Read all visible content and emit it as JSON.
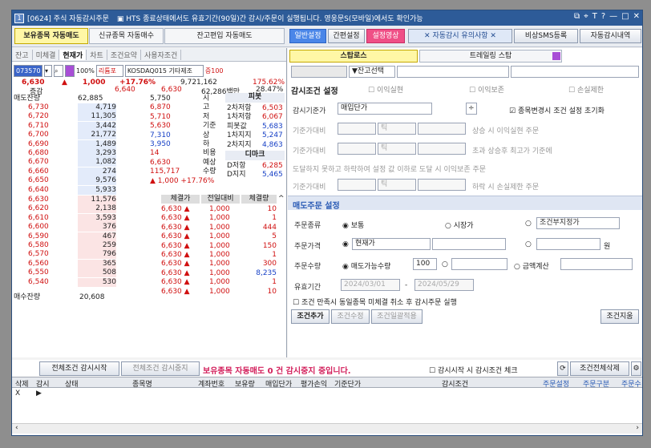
{
  "title": {
    "code": "[0624] 주식 자동감시주문",
    "notice": "▣ HTS 종료상태에서도 유효기간(90일)간 감시/주문이 실행됩니다. 영웅문S(모바일)에서도 확인가능"
  },
  "tabs": [
    "보유종목 자동매도",
    "신규종목 자동매수",
    "잔고편입 자동매도"
  ],
  "buttons": {
    "general": "일반설정",
    "simple": "간편설정",
    "setting_video": "설정영상",
    "caution": "✕ 자동감시 유의사항 ✕",
    "sms": "비상SMS등록",
    "history": "자동감시내역"
  },
  "left": {
    "subtabs": [
      "잔고",
      "미체결",
      "현재가",
      "차트",
      "조건요약",
      "사용자조건"
    ],
    "code": "073570",
    "pct": "100%",
    "logo_label": "리튬포",
    "stock_name": "KOSDAQ015 기타제조",
    "tag": "증100",
    "price": "6,630",
    "diff_arrow": "▲",
    "diff": "1,000",
    "rate": "+17.76%",
    "volume": "9,721,162",
    "vol_rate": "175.62%",
    "row2": [
      "증감",
      "6,640",
      "6,630",
      "62,286백만",
      "28.47%"
    ],
    "ask_title": "매도잔량",
    "asks": [
      [
        "6,730",
        "4,719"
      ],
      [
        "6,720",
        "11,305"
      ],
      [
        "6,710",
        "3,442"
      ],
      [
        "6,700",
        "21,772"
      ],
      [
        "6,690",
        "1,489"
      ],
      [
        "6,680",
        "3,293"
      ],
      [
        "6,670",
        "1,082"
      ],
      [
        "6,660",
        "274"
      ],
      [
        "6,650",
        "9,576"
      ],
      [
        "6,640",
        "5,933"
      ]
    ],
    "bids": [
      [
        "6,630",
        "11,576"
      ],
      [
        "6,620",
        "2,138"
      ],
      [
        "6,610",
        "3,593"
      ],
      [
        "6,600",
        "376"
      ],
      [
        "6,590",
        "467"
      ],
      [
        "6,580",
        "259"
      ],
      [
        "6,570",
        "796"
      ],
      [
        "6,560",
        "365"
      ],
      [
        "6,550",
        "508"
      ],
      [
        "6,540",
        "530"
      ]
    ],
    "total_ask": "62,885",
    "total_bid": "20,608",
    "bid_title": "매수잔량",
    "info": [
      [
        "5,750",
        "시"
      ],
      [
        "6,870",
        "고"
      ],
      [
        "5,710",
        "저"
      ],
      [
        "5,630",
        "기준"
      ],
      [
        "7,310",
        "상"
      ],
      [
        "3,950",
        "하"
      ],
      [
        "14",
        "비용"
      ],
      [
        "6,630",
        "예상"
      ],
      [
        "115,717",
        "수량"
      ],
      [
        "▲ 1,000 +17.76%",
        ""
      ]
    ],
    "pivot_title": "피봇",
    "pivot": [
      [
        "2차저항",
        "6,503"
      ],
      [
        "1차저항",
        "6,067"
      ],
      [
        "피봇값",
        "5,683"
      ],
      [
        "1차지지",
        "5,247"
      ],
      [
        "2차지지",
        "4,863"
      ]
    ],
    "dmark_title": "디마크",
    "dmark": [
      [
        "D저항",
        "6,285"
      ],
      [
        "D지지",
        "5,465"
      ]
    ],
    "trade_head": [
      "체결가",
      "전일대비",
      "체결량"
    ],
    "trades": [
      [
        "6,630",
        "1,000",
        "10"
      ],
      [
        "6,630",
        "1,000",
        "1"
      ],
      [
        "6,630",
        "1,000",
        "444"
      ],
      [
        "6,630",
        "1,000",
        "5"
      ],
      [
        "6,630",
        "1,000",
        "150"
      ],
      [
        "6,630",
        "1,000",
        "1"
      ],
      [
        "6,630",
        "1,000",
        "300"
      ],
      [
        "6,630",
        "1,000",
        "8,235"
      ],
      [
        "6,630",
        "1,000",
        "1"
      ],
      [
        "6,630",
        "1,000",
        "10"
      ]
    ]
  },
  "right": {
    "tab1": "스탑로스",
    "tab2": "트레일링 스탑",
    "balance_btn": "▼잔고선택",
    "cond_title": "감시조건 설정",
    "chk_profit": "이익실현",
    "chk_protect": "이익보존",
    "chk_loss": "손실제한",
    "base_label": "감시기준가",
    "base_value": "매입단가",
    "reset_label": "종목변경시 조건 설정 초기화",
    "rows": [
      "기준가대비",
      "기준가대비",
      "도달하지 못하고 하락하여 설정 값 이하로 도달 시  이익보존 주문",
      "기준가대비"
    ],
    "tick": "틱",
    "r1": "상승 시  이익실현  주문",
    "r2": "초과 상승후 최고가 기준에",
    "r4": "하락 시 손실제한 주문",
    "order_title": "매도주문 설정",
    "type_label": "주문종류",
    "type_normal": "보통",
    "type_market": "시장가",
    "type_cond": "조건부지정가",
    "price_label": "주문가격",
    "price_value": "현재가",
    "won": "원",
    "qty_label": "주문수량",
    "qty_value": "매도가능수량",
    "qty_pct": "100",
    "amount": "금액계산",
    "qty_unit": "원",
    "valid_label": "유효기간",
    "date_from": "2024/03/01",
    "date_to": "2024/05/29",
    "auto_cancel": "조건 만족시 동일종목 미체결 취소 후 감시주문 실행",
    "add": "조건추가",
    "edit": "조건수정",
    "batch": "조건일괄적용",
    "clear": "조건지움"
  },
  "bottom": {
    "start_all": "전체조건 감시시작",
    "stop_all": "전체조건 감시중지",
    "status": "보유종목 자동매도 0 건 감시중지 중입니다.",
    "check_label": "감시시작 시 감시조건 체크",
    "delete_all": "조건전체삭제",
    "cols": [
      "삭제",
      "감시",
      "상태",
      "종목명",
      "계좌번호",
      "보유량",
      "매입단가",
      "평가손익",
      "기준단가",
      "감시조건",
      "주문설정",
      "주문구분",
      "주문수"
    ]
  }
}
